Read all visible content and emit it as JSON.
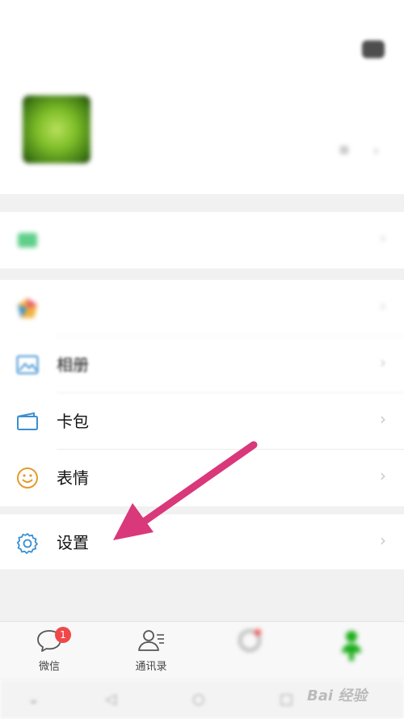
{
  "menu": {
    "items": [
      {
        "label": "相册",
        "blurred": true
      },
      {
        "label": "卡包",
        "blurred": false
      },
      {
        "label": "表情",
        "blurred": false
      },
      {
        "label": "设置",
        "blurred": false
      }
    ]
  },
  "tabbar": {
    "tabs": [
      {
        "label": "微信",
        "badge": "1"
      },
      {
        "label": "通讯录"
      }
    ]
  },
  "watermark": {
    "text": "Bai 经验"
  },
  "colors": {
    "accent_arrow": "#d9387a",
    "icon_blue": "#3b8fd1",
    "icon_orange": "#e69a2e",
    "badge_red": "#f04848"
  }
}
